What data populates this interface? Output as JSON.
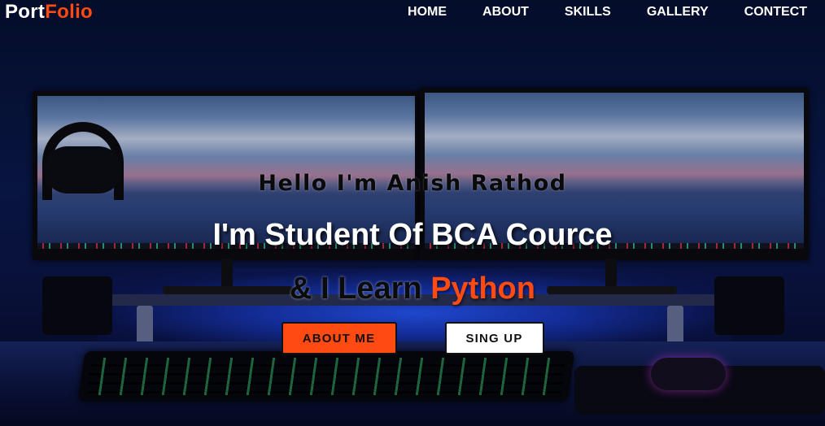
{
  "brand": {
    "name_part1": "Port",
    "name_part2": "Folio",
    "accent_color": "#ff4a12"
  },
  "nav": {
    "items": [
      {
        "label": "HOME"
      },
      {
        "label": "ABOUT"
      },
      {
        "label": "SKILLS"
      },
      {
        "label": "GALLERY"
      },
      {
        "label": "CONTECT"
      }
    ]
  },
  "hero": {
    "greeting": "Hello I'm Anish Rathod",
    "course": "I'm Student Of BCA Cource",
    "learn_prefix": "& I Learn",
    "learn_highlight": "Python",
    "buttons": {
      "primary": "ABOUT ME",
      "secondary": "SING UP"
    },
    "background_image": "desk-setup-photo"
  }
}
